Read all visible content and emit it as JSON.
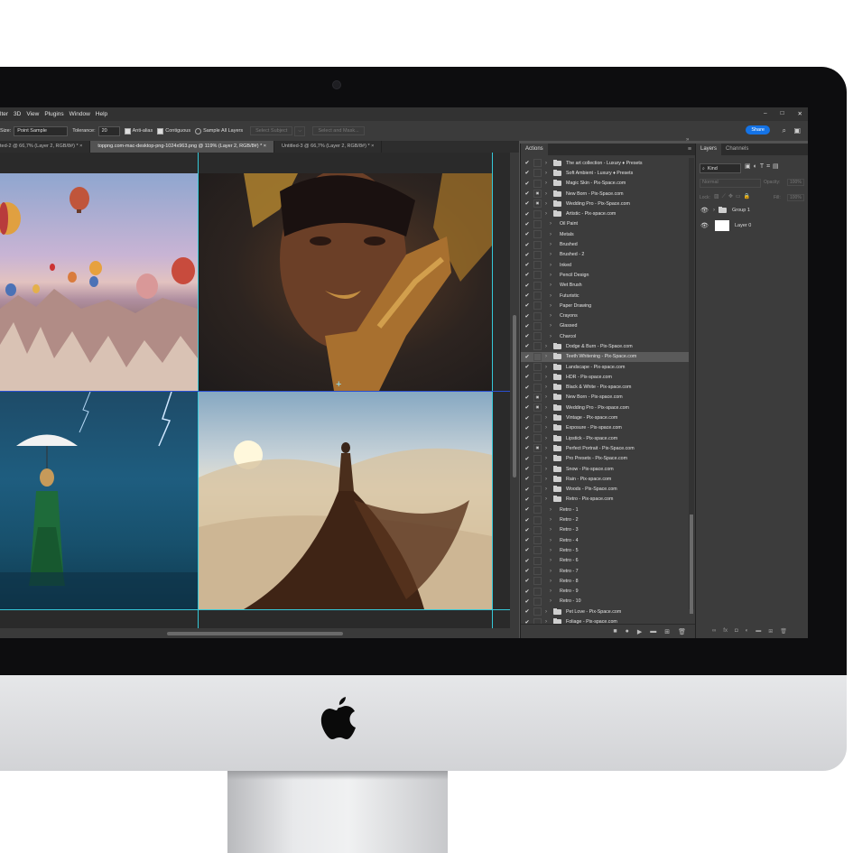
{
  "menubar": {
    "items": [
      "lter",
      "3D",
      "View",
      "Plugins",
      "Window",
      "Help"
    ],
    "window_controls": [
      "–",
      "□",
      "✕"
    ]
  },
  "options": {
    "size_label": "Size:",
    "size_value": "Point Sample",
    "tolerance_label": "Tolerance:",
    "tolerance_value": "20",
    "antialias": "Anti-alias",
    "contiguous": "Contiguous",
    "sample_all": "Sample All Layers",
    "select_subject": "Select Subject",
    "select_mask": "Select and Mask...",
    "share": "Share"
  },
  "tabs": [
    "ted-2 @ 66,7% (Layer 2, RGB/8#) *  ×",
    "toppng.com-mac-desktop-png-1024x963.png @ 119% (Layer 2, RGB/8#) *  ×",
    "Untitled-3 @ 66,7% (Layer 2, RGB/8#) *  ×"
  ],
  "actions_panel": {
    "title": "Actions",
    "items": [
      {
        "label": "The art collection - Luxury ♦ Presets",
        "level": 0,
        "check": "✔",
        "box": "",
        "sel": false
      },
      {
        "label": "Soft Ambient - Luxury ♦ Presets",
        "level": 0,
        "check": "✔",
        "box": "",
        "sel": false
      },
      {
        "label": "Magic Skin - Pix-Space.com",
        "level": 0,
        "check": "✔",
        "box": "",
        "sel": false
      },
      {
        "label": "New Born - Pix-Space.com",
        "level": 0,
        "check": "✔",
        "box": "▣",
        "sel": false
      },
      {
        "label": "Wedding Pro - Pix-Space.com",
        "level": 0,
        "check": "✔",
        "box": "▣",
        "sel": false
      },
      {
        "label": "Artistic - Pix-space.com",
        "level": 0,
        "check": "✔",
        "box": "",
        "sel": false
      },
      {
        "label": "Oil Paint",
        "level": 1,
        "check": "✔",
        "box": "",
        "sel": false
      },
      {
        "label": "Metals",
        "level": 1,
        "check": "✔",
        "box": "",
        "sel": false
      },
      {
        "label": "Brushed",
        "level": 1,
        "check": "✔",
        "box": "",
        "sel": false
      },
      {
        "label": "Brushed - 2",
        "level": 1,
        "check": "✔",
        "box": "",
        "sel": false
      },
      {
        "label": "Inked",
        "level": 1,
        "check": "✔",
        "box": "",
        "sel": false
      },
      {
        "label": "Pencil Design",
        "level": 1,
        "check": "✔",
        "box": "",
        "sel": false
      },
      {
        "label": "Wet Brush",
        "level": 1,
        "check": "✔",
        "box": "",
        "sel": false
      },
      {
        "label": "Futuristic",
        "level": 1,
        "check": "✔",
        "box": "",
        "sel": false
      },
      {
        "label": "Paper Drawing",
        "level": 1,
        "check": "✔",
        "box": "",
        "sel": false
      },
      {
        "label": "Crayons",
        "level": 1,
        "check": "✔",
        "box": "",
        "sel": false
      },
      {
        "label": "Glassed",
        "level": 1,
        "check": "✔",
        "box": "",
        "sel": false
      },
      {
        "label": "Charcol",
        "level": 1,
        "check": "✔",
        "box": "",
        "sel": false
      },
      {
        "label": "Dodge & Burn - Pix-Space.com",
        "level": 0,
        "check": "✔",
        "box": "",
        "sel": false
      },
      {
        "label": "Teeth Whitening - Pix-Space.com",
        "level": 0,
        "check": "✔",
        "box": "",
        "sel": true
      },
      {
        "label": "Landscape - Pix-space.com",
        "level": 0,
        "check": "✔",
        "box": "",
        "sel": false
      },
      {
        "label": "HDR - Pix-space.com",
        "level": 0,
        "check": "✔",
        "box": "",
        "sel": false
      },
      {
        "label": "Black & White - Pix-space.com",
        "level": 0,
        "check": "✔",
        "box": "",
        "sel": false
      },
      {
        "label": "New Born - Pix-space.com",
        "level": 0,
        "check": "✔",
        "box": "▣",
        "sel": false
      },
      {
        "label": "Wedding Pro - Pix-space.com",
        "level": 0,
        "check": "✔",
        "box": "▣",
        "sel": false
      },
      {
        "label": "Vintage - Pix-space.com",
        "level": 0,
        "check": "✔",
        "box": "",
        "sel": false
      },
      {
        "label": "Exposure - Pix-space.com",
        "level": 0,
        "check": "✔",
        "box": "",
        "sel": false
      },
      {
        "label": "Lipstick - Pix-space.com",
        "level": 0,
        "check": "✔",
        "box": "",
        "sel": false
      },
      {
        "label": "Perfect Portrait - Pix-Space.com",
        "level": 0,
        "check": "✔",
        "box": "▣",
        "sel": false
      },
      {
        "label": "Pro Presets - Pix-Space.com",
        "level": 0,
        "check": "✔",
        "box": "",
        "sel": false
      },
      {
        "label": "Snow - Pix-space.com",
        "level": 0,
        "check": "✔",
        "box": "",
        "sel": false
      },
      {
        "label": "Rain - Pix-space.com",
        "level": 0,
        "check": "✔",
        "box": "",
        "sel": false
      },
      {
        "label": "Woods - Pix-Space.com",
        "level": 0,
        "check": "✔",
        "box": "",
        "sel": false
      },
      {
        "label": "Retro - Pix-space.com",
        "level": 0,
        "check": "✔",
        "box": "",
        "sel": false
      },
      {
        "label": "Retro - 1",
        "level": 1,
        "check": "✔",
        "box": "",
        "sel": false
      },
      {
        "label": "Retro - 2",
        "level": 1,
        "check": "✔",
        "box": "",
        "sel": false
      },
      {
        "label": "Retro - 3",
        "level": 1,
        "check": "✔",
        "box": "",
        "sel": false
      },
      {
        "label": "Retro - 4",
        "level": 1,
        "check": "✔",
        "box": "",
        "sel": false
      },
      {
        "label": "Retro - 5",
        "level": 1,
        "check": "✔",
        "box": "",
        "sel": false
      },
      {
        "label": "Retro - 6",
        "level": 1,
        "check": "✔",
        "box": "",
        "sel": false
      },
      {
        "label": "Retro - 7",
        "level": 1,
        "check": "✔",
        "box": "",
        "sel": false
      },
      {
        "label": "Retro - 8",
        "level": 1,
        "check": "✔",
        "box": "",
        "sel": false
      },
      {
        "label": "Retro - 9",
        "level": 1,
        "check": "✔",
        "box": "",
        "sel": false
      },
      {
        "label": "Retro - 10",
        "level": 1,
        "check": "✔",
        "box": "",
        "sel": false
      },
      {
        "label": "Pet Love - Pix-Space.com",
        "level": 0,
        "check": "✔",
        "box": "",
        "sel": false
      },
      {
        "label": "Foliage - Pix-space.com",
        "level": 0,
        "check": "✔",
        "box": "",
        "sel": false
      }
    ],
    "footer_icons": [
      "■",
      "●",
      "▶",
      "▬",
      "⊞",
      "🗑"
    ]
  },
  "layers_panel": {
    "tabs": [
      "Layers",
      "Channels"
    ],
    "filter": "Kind",
    "blend": "Normal",
    "opacity_label": "Opacity:",
    "opacity_value": "100%",
    "lock_label": "Lock:",
    "fill_label": "Fill:",
    "fill_value": "100%",
    "layers": [
      "Group 1",
      "Layer 0"
    ],
    "footer_icons": [
      "∞",
      "fx",
      "◘",
      "◐",
      "▬",
      "⊞",
      "🗑"
    ]
  },
  "colors": {
    "accent": "#1473e6",
    "guide": "#35c8d8",
    "panel": "#3c3c3c"
  }
}
